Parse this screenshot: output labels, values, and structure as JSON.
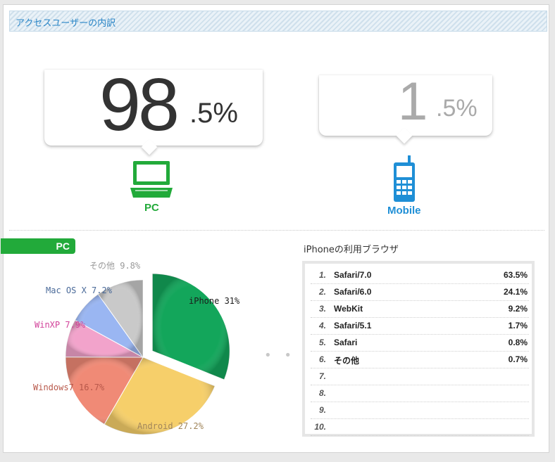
{
  "header": {
    "title": "アクセスユーザーの内訳"
  },
  "pc_share": {
    "big": "98",
    "small": ".5%",
    "caption": "PC",
    "icon": "laptop-icon",
    "color": "#22aa3a"
  },
  "mobile_share": {
    "big": "1",
    "small": ".5%",
    "caption": "Mobile",
    "icon": "mobile-phone-icon",
    "color": "#1f8fd6"
  },
  "pc_tab": {
    "label": "PC"
  },
  "chart_data": {
    "type": "pie",
    "title": "",
    "slices": [
      {
        "label": "iPhone 31%",
        "value": 31,
        "color": "#13a65b",
        "label_color": "#1b1b1b",
        "exploded": true
      },
      {
        "label": "Android 27.2%",
        "value": 27.2,
        "color": "#f6cf6a",
        "label_color": "#a0855a"
      },
      {
        "label": "Windows7 16.7%",
        "value": 16.7,
        "color": "#f08a76",
        "label_color": "#b8584a"
      },
      {
        "label": "WinXP 7.9%",
        "value": 7.9,
        "color": "#f2a3cb",
        "label_color": "#d2429a"
      },
      {
        "label": "Mac OS X 7.2%",
        "value": 7.2,
        "color": "#9ab6f2",
        "label_color": "#4a6a99"
      },
      {
        "label": "その他 9.8%",
        "value": 9.8,
        "color": "#c9c9c9",
        "label_color": "#9a9a9a"
      }
    ]
  },
  "browsers": {
    "title": "iPhoneの利用ブラウザ",
    "rows": [
      {
        "rank": "1.",
        "name": "Safari/7.0",
        "value": "63.5%"
      },
      {
        "rank": "2.",
        "name": "Safari/6.0",
        "value": "24.1%"
      },
      {
        "rank": "3.",
        "name": "WebKit",
        "value": "9.2%"
      },
      {
        "rank": "4.",
        "name": "Safari/5.1",
        "value": "1.7%"
      },
      {
        "rank": "5.",
        "name": "Safari",
        "value": "0.8%"
      },
      {
        "rank": "6.",
        "name": "その他",
        "value": "0.7%"
      },
      {
        "rank": "7.",
        "name": "",
        "value": ""
      },
      {
        "rank": "8.",
        "name": "",
        "value": ""
      },
      {
        "rank": "9.",
        "name": "",
        "value": ""
      },
      {
        "rank": "10.",
        "name": "",
        "value": ""
      }
    ]
  },
  "separator": "• • •"
}
